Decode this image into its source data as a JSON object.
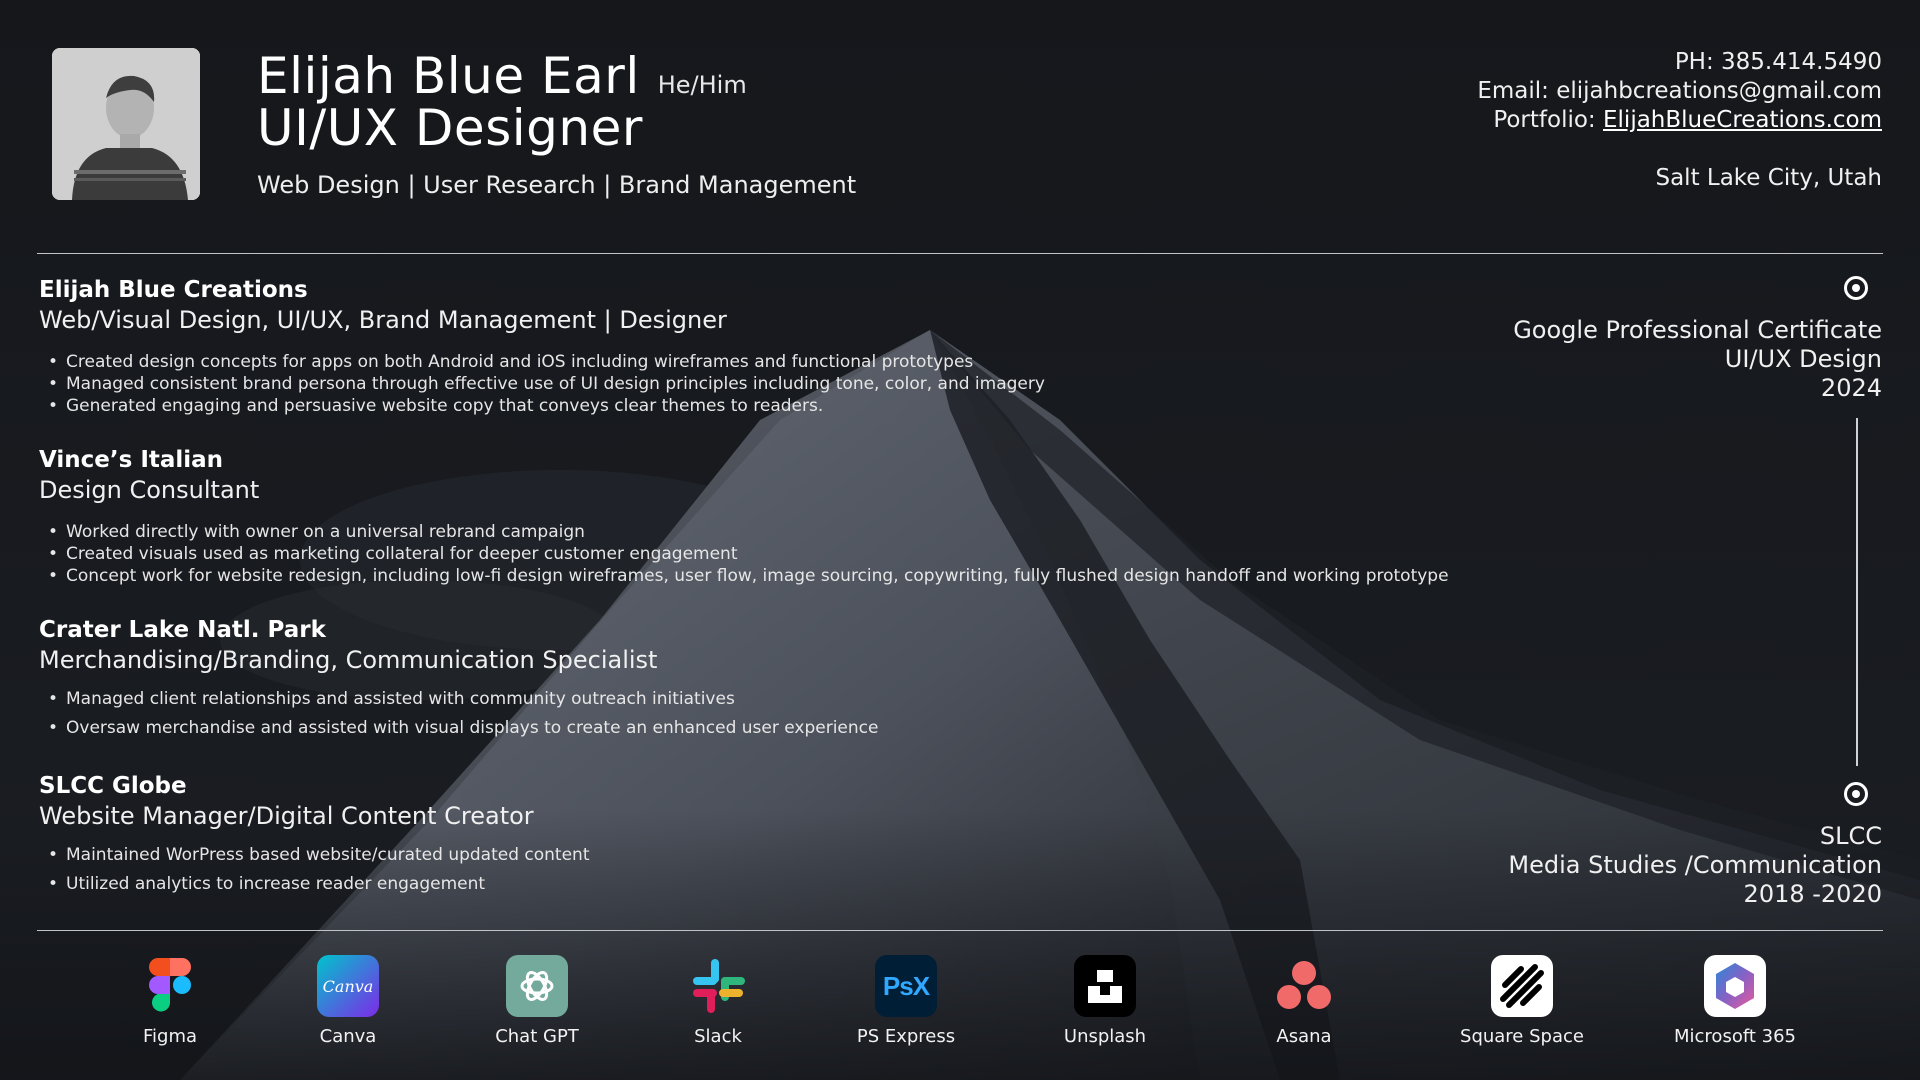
{
  "header": {
    "name": "Elijah Blue Earl",
    "pronouns": "He/Him",
    "role": "UI/UX Designer",
    "skills": "Web Design | User Research | Brand Management"
  },
  "contact": {
    "phone": "PH: 385.414.5490",
    "email": "Email: elijahbcreations@gmail.com",
    "portfolio_label": "Portfolio:",
    "portfolio_link": "ElijahBlueCreations.com",
    "location": "Salt Lake City, Utah"
  },
  "experience": [
    {
      "company": "Elijah Blue Creations",
      "title": "Web/Visual Design, UI/UX, Brand Management | Designer",
      "bullets": [
        "Created design concepts for apps on both Android and iOS including wireframes and functional prototypes",
        "Managed consistent brand persona through effective use of UI design principles including tone, color, and imagery",
        "Generated engaging and persuasive website copy that conveys clear themes to readers."
      ]
    },
    {
      "company": "Vince’s Italian",
      "title": "Design Consultant",
      "bullets": [
        "Worked directly with owner on a universal rebrand campaign",
        "Created visuals used as marketing collateral for deeper customer engagement",
        "Concept work for website redesign, including low-fi design wireframes, user flow, image sourcing, copywriting, fully flushed design handoff and working prototype"
      ]
    },
    {
      "company": "Crater Lake Natl. Park",
      "title": "Merchandising/Branding, Communication Specialist",
      "bullets": [
        "Managed client relationships and assisted with community outreach initiatives",
        "Oversaw merchandise and assisted with visual displays to create an enhanced user experience"
      ]
    },
    {
      "company": "SLCC Globe",
      "title": "Website Manager/Digital Content Creator",
      "bullets": [
        "Maintained WorPress based website/curated updated content",
        "Utilized analytics to increase reader engagement"
      ]
    }
  ],
  "education": [
    {
      "line1": "Google Professional Certificate",
      "line2": "UI/UX Design",
      "line3": "2024"
    },
    {
      "line1": "SLCC",
      "line2": "Media Studies /Communication",
      "line3": "2018 -2020"
    }
  ],
  "tools": [
    {
      "label": "Figma",
      "icon": "figma-icon"
    },
    {
      "label": "Canva",
      "icon": "canva-icon",
      "icon_text": "Canva"
    },
    {
      "label": "Chat GPT",
      "icon": "chatgpt-icon"
    },
    {
      "label": "Slack",
      "icon": "slack-icon"
    },
    {
      "label": "PS Express",
      "icon": "ps-express-icon",
      "icon_text": "PsX"
    },
    {
      "label": "Unsplash",
      "icon": "unsplash-icon"
    },
    {
      "label": "Asana",
      "icon": "asana-icon"
    },
    {
      "label": "Square Space",
      "icon": "squarespace-icon"
    },
    {
      "label": "Microsoft 365",
      "icon": "microsoft-365-icon"
    }
  ],
  "colors": {
    "background": "#121418",
    "text": "#ffffff",
    "divider": "#bfc3c9",
    "canva": "#7d2ae8",
    "chatgpt": "#74aa9c",
    "ps_express": "#001e36"
  }
}
